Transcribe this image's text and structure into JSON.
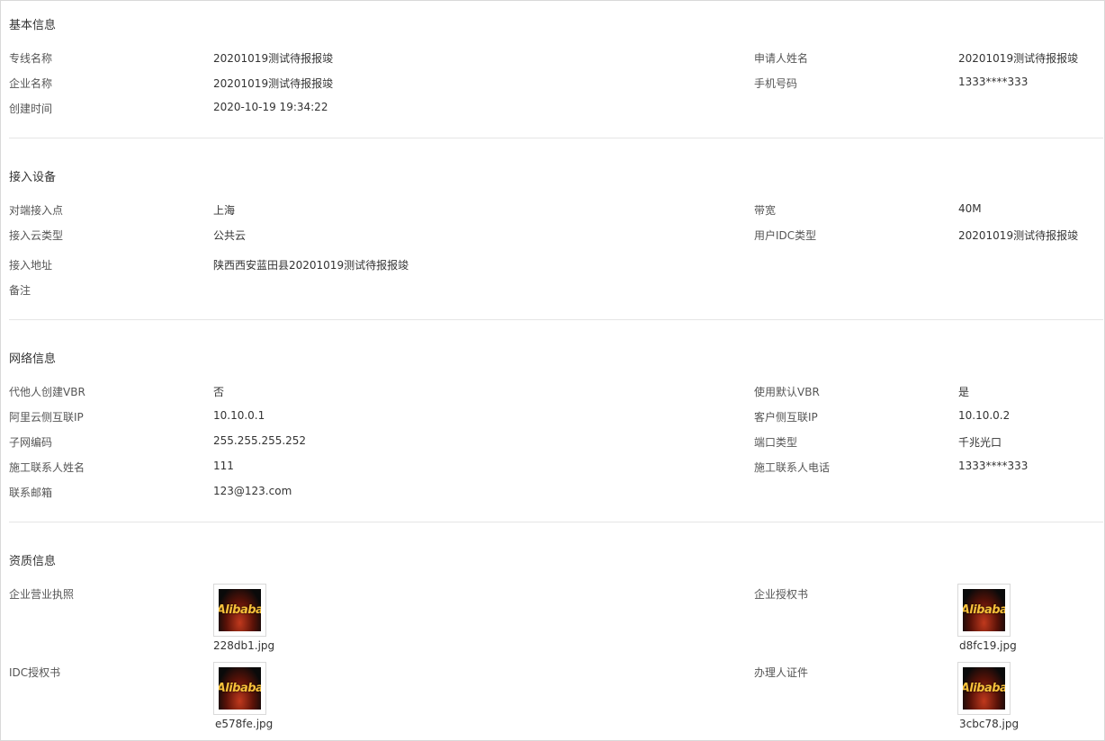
{
  "sections": {
    "basic": {
      "title": "基本信息",
      "line_name_label": "专线名称",
      "line_name": "20201019测试待报报竣",
      "applicant_label": "申请人姓名",
      "applicant": "20201019测试待报报竣",
      "company_label": "企业名称",
      "company": "20201019测试待报报竣",
      "phone_label": "手机号码",
      "phone": "1333****333",
      "created_label": "创建时间",
      "created": "2020-10-19 19:34:22"
    },
    "access": {
      "title": "接入设备",
      "peer_point_label": "对端接入点",
      "peer_point": "上海",
      "bandwidth_label": "带宽",
      "bandwidth": "40M",
      "cloud_type_label": "接入云类型",
      "cloud_type": "公共云",
      "idc_type_label": "用户IDC类型",
      "idc_type": "20201019测试待报报竣",
      "address_label": "接入地址",
      "address": "陕西西安蓝田县20201019测试待报报竣",
      "remark_label": "备注",
      "remark": ""
    },
    "network": {
      "title": "网络信息",
      "proxy_vbr_label": "代他人创建VBR",
      "proxy_vbr": "否",
      "default_vbr_label": "使用默认VBR",
      "default_vbr": "是",
      "ali_ip_label": "阿里云侧互联IP",
      "ali_ip": "10.10.0.1",
      "client_ip_label": "客户侧互联IP",
      "client_ip": "10.10.0.2",
      "subnet_label": "子网编码",
      "subnet": "255.255.255.252",
      "port_type_label": "端口类型",
      "port_type": "千兆光口",
      "contact_name_label": "施工联系人姓名",
      "contact_name": "111",
      "contact_phone_label": "施工联系人电话",
      "contact_phone": "1333****333",
      "email_label": "联系邮箱",
      "email": "123@123.com"
    },
    "qualification": {
      "title": "资质信息",
      "license_label": "企业营业执照",
      "license_file": "228db1.jpg",
      "auth_label": "企业授权书",
      "auth_file": "d8fc19.jpg",
      "idc_auth_label": "IDC授权书",
      "idc_auth_file": "e578fe.jpg",
      "id_label": "办理人证件",
      "id_file": "3cbc78.jpg",
      "thumb_text": "Alibaba"
    }
  }
}
